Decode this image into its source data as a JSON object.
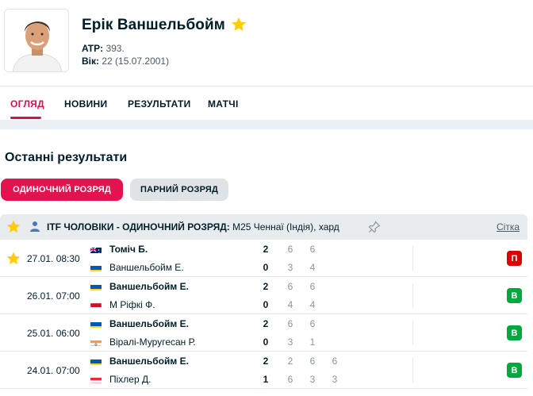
{
  "player": {
    "name": "Ерік Ваншельбойм",
    "atp_label": "ATP:",
    "atp_value": "393.",
    "age_label": "Вік:",
    "age_value": "22 (15.07.2001)"
  },
  "tabs": [
    {
      "label": "ОГЛЯД",
      "active": true
    },
    {
      "label": "НОВИНИ"
    },
    {
      "label": "РЕЗУЛЬТАТИ"
    },
    {
      "label": "МАТЧІ"
    }
  ],
  "section_title": "Останні результати",
  "filters": {
    "singles": "ОДИНОЧНИЙ РОЗРЯД",
    "doubles": "ПАРНИЙ РОЗРЯД"
  },
  "tournament": {
    "category": "ITF ЧОЛОВІКИ - ОДИНОЧНИЙ РОЗРЯД:",
    "name": "M25 Ченнаї (Індія), хард",
    "draw_link": "Сітка"
  },
  "matches": [
    {
      "time": "27.01. 08:30",
      "starred": true,
      "p1": {
        "name": "Томіч Б.",
        "flag": "australia-flag",
        "total": "2",
        "sets": [
          "6",
          "6"
        ]
      },
      "p2": {
        "name": "Ваншельбойм Е.",
        "flag": "ukraine-flag",
        "total": "0",
        "sets": [
          "3",
          "4"
        ]
      },
      "result": "П"
    },
    {
      "time": "26.01. 07:00",
      "starred": false,
      "p1": {
        "name": "Ваншельбойм Е.",
        "flag": "ukraine-flag",
        "total": "2",
        "sets": [
          "6",
          "6"
        ]
      },
      "p2": {
        "name": "М Ріфкі Ф.",
        "flag": "indonesia-flag",
        "total": "0",
        "sets": [
          "4",
          "4"
        ]
      },
      "result": "В"
    },
    {
      "time": "25.01. 06:00",
      "starred": false,
      "p1": {
        "name": "Ваншельбойм Е.",
        "flag": "ukraine-flag",
        "total": "2",
        "sets": [
          "6",
          "6"
        ]
      },
      "p2": {
        "name": "Вірaлі-Муругесан Р.",
        "flag": "india-flag",
        "total": "0",
        "sets": [
          "3",
          "1"
        ]
      },
      "result": "В"
    },
    {
      "time": "24.01. 07:00",
      "starred": false,
      "p1": {
        "name": "Ваншельбойм Е.",
        "flag": "ukraine-flag",
        "total": "2",
        "sets": [
          "2",
          "6",
          "6"
        ]
      },
      "p2": {
        "name": "Піхлер Д.",
        "flag": "austria-flag",
        "total": "1",
        "sets": [
          "6",
          "3",
          "3"
        ]
      },
      "result": "В"
    }
  ],
  "colors": {
    "accent": "#d8114c",
    "win": "#00a83f",
    "loss": "#dc0000",
    "star": "#ffcd00"
  }
}
